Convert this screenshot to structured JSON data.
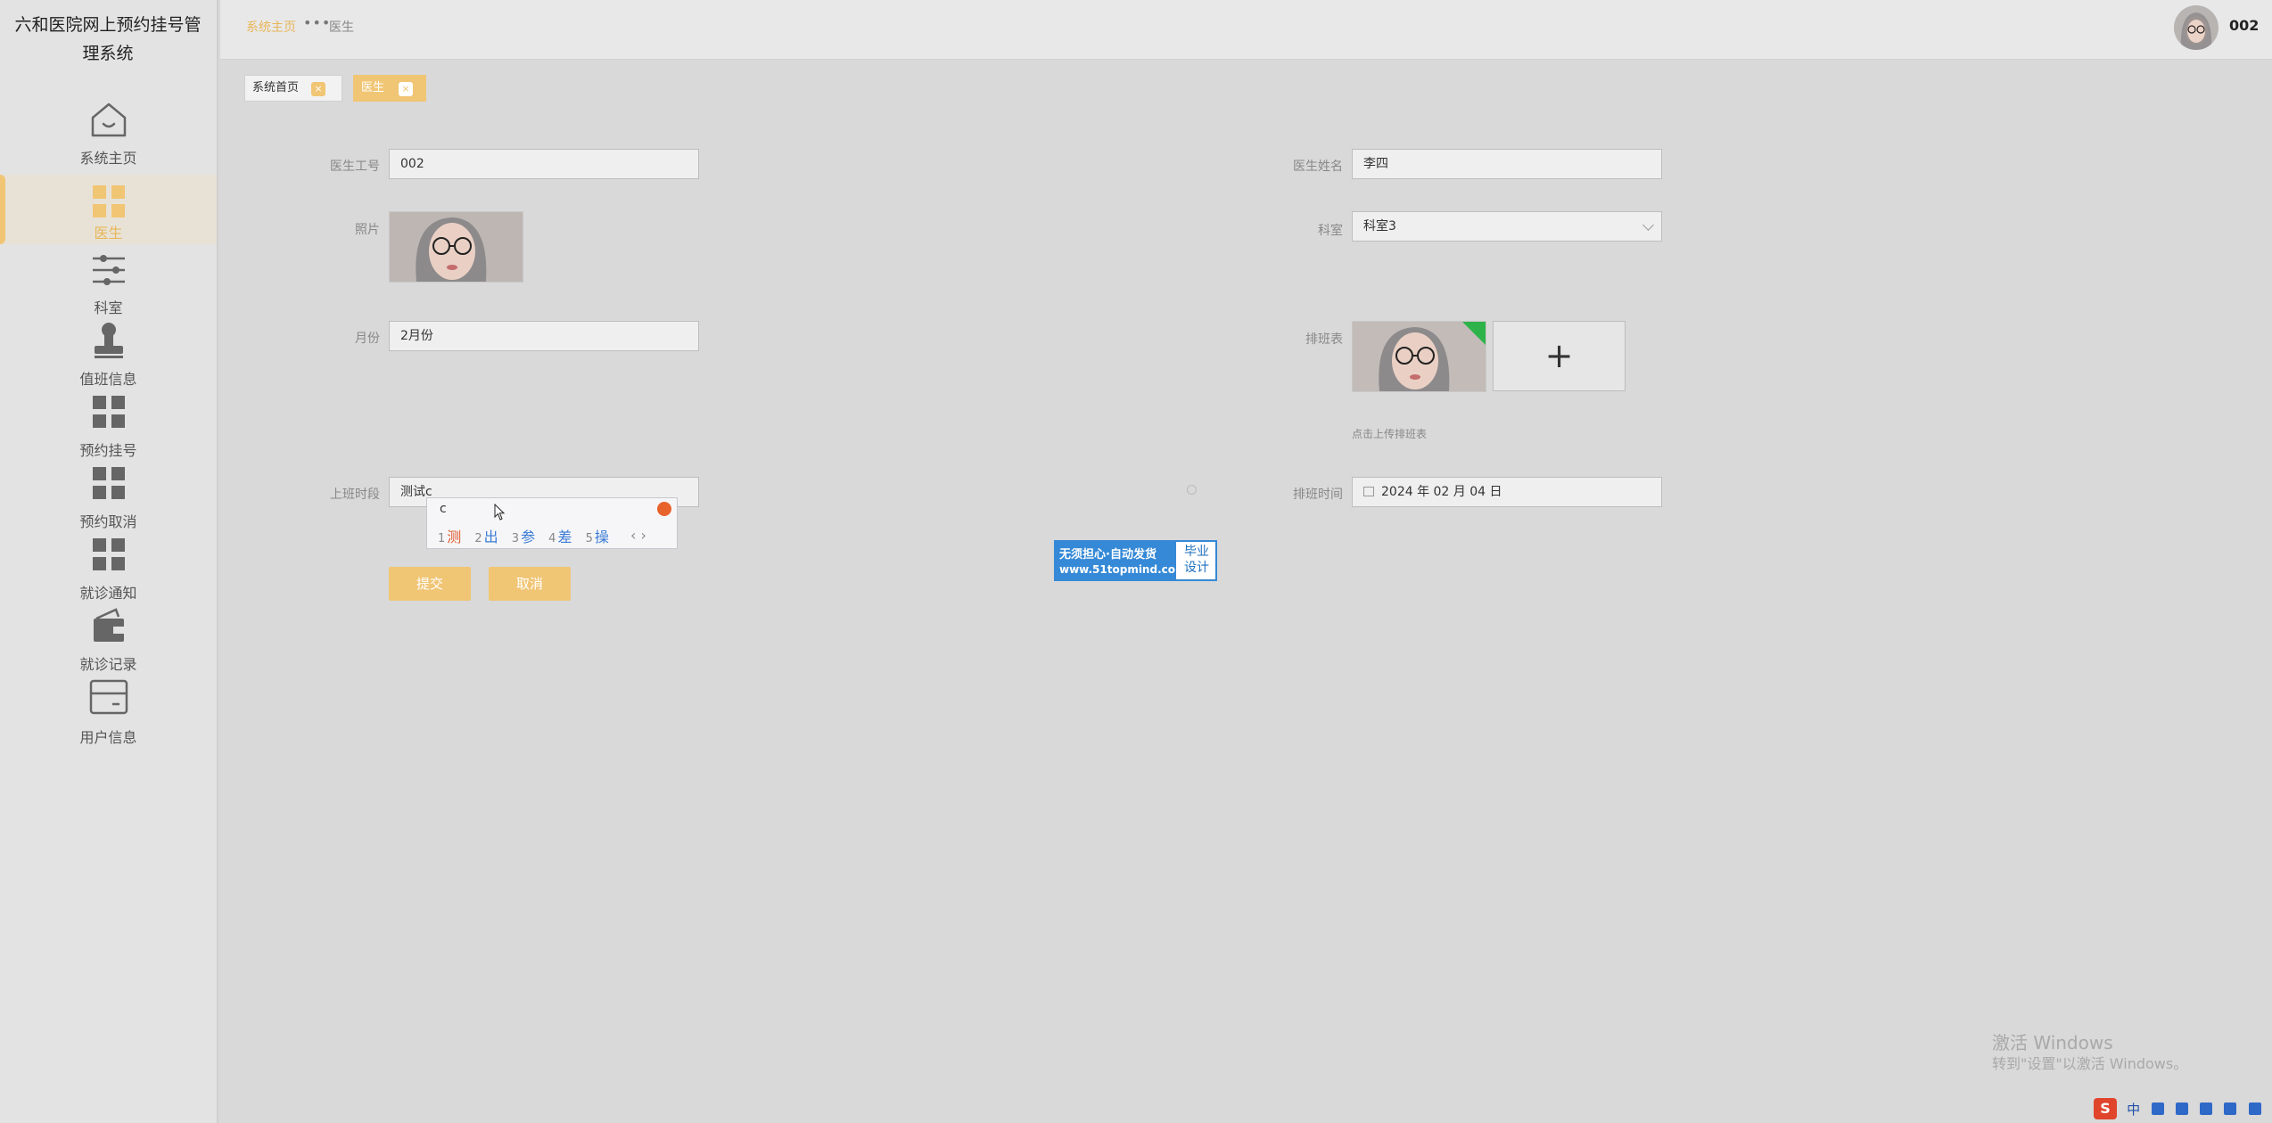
{
  "app": {
    "title": "六和医院网上预约挂号管理系统"
  },
  "sidebar": {
    "items": [
      {
        "label": "系统主页",
        "icon": "home-icon"
      },
      {
        "label": "医生",
        "icon": "grid-icon",
        "active": true
      },
      {
        "label": "科室",
        "icon": "sliders-icon"
      },
      {
        "label": "值班信息",
        "icon": "stamp-icon"
      },
      {
        "label": "预约挂号",
        "icon": "grid-icon"
      },
      {
        "label": "预约取消",
        "icon": "grid-icon"
      },
      {
        "label": "就诊通知",
        "icon": "grid-icon"
      },
      {
        "label": "就诊记录",
        "icon": "wallet-icon"
      },
      {
        "label": "用户信息",
        "icon": "card-icon"
      }
    ]
  },
  "breadcrumb": {
    "home": "系统主页",
    "separator": "•••",
    "current": "医生"
  },
  "user": {
    "name": "002"
  },
  "tabs": [
    {
      "label": "系统首页",
      "close": "×"
    },
    {
      "label": "医生",
      "close": "×",
      "active": true
    }
  ],
  "form": {
    "doctor_id": {
      "label": "医生工号",
      "value": "002"
    },
    "doctor_name": {
      "label": "医生姓名",
      "value": "李四"
    },
    "photo": {
      "label": "照片"
    },
    "department": {
      "label": "科室",
      "value": "科室3"
    },
    "month": {
      "label": "月份",
      "value": "2月份"
    },
    "schedule_table": {
      "label": "排班表",
      "upload_symbol": "+",
      "upload_hint": "点击上传排班表"
    },
    "work_time": {
      "label": "上班时段",
      "value": "测试c"
    },
    "schedule_date": {
      "label": "排班时间",
      "value": "2024 年 02 月 04 日"
    },
    "submit_label": "提交",
    "cancel_label": "取消"
  },
  "ime": {
    "input": "c",
    "candidates": [
      {
        "num": "1",
        "word": "测"
      },
      {
        "num": "2",
        "word": "出"
      },
      {
        "num": "3",
        "word": "参"
      },
      {
        "num": "4",
        "word": "差"
      },
      {
        "num": "5",
        "word": "操"
      }
    ],
    "nav": "‹ ›"
  },
  "ad": {
    "line1": "无须担心·自动发货",
    "line2": "www.51topmind.com",
    "right1": "毕业",
    "right2": "设计"
  },
  "watermark": {
    "line1": "激活 Windows",
    "line2": "转到\"设置\"以激活 Windows。"
  },
  "tray": {
    "logo": "S",
    "lang": "中"
  },
  "colors": {
    "accent": "#f0c574",
    "accent_text": "#e9b659",
    "background": "#d9d9d9",
    "sidebar": "#e3e3e3"
  }
}
